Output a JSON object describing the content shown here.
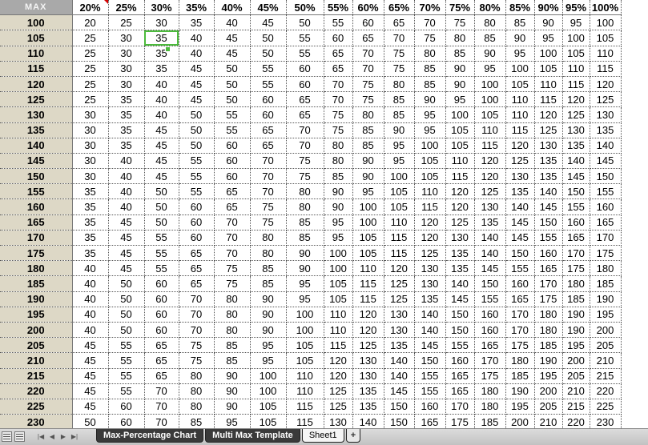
{
  "sheet": {
    "corner_label": "MAX",
    "percent_headers": [
      "20%",
      "25%",
      "30%",
      "35%",
      "40%",
      "45%",
      "50%",
      "55%",
      "60%",
      "65%",
      "70%",
      "75%",
      "80%",
      "85%",
      "90%",
      "95%",
      "100%"
    ],
    "rows": [
      {
        "max": "100",
        "values": [
          "20",
          "25",
          "30",
          "35",
          "40",
          "45",
          "50",
          "55",
          "60",
          "65",
          "70",
          "75",
          "80",
          "85",
          "90",
          "95",
          "100"
        ]
      },
      {
        "max": "105",
        "values": [
          "25",
          "30",
          "35",
          "40",
          "45",
          "50",
          "55",
          "60",
          "65",
          "70",
          "75",
          "80",
          "85",
          "90",
          "95",
          "100",
          "105"
        ]
      },
      {
        "max": "110",
        "values": [
          "25",
          "30",
          "35",
          "40",
          "45",
          "50",
          "55",
          "65",
          "70",
          "75",
          "80",
          "85",
          "90",
          "95",
          "100",
          "105",
          "110"
        ]
      },
      {
        "max": "115",
        "values": [
          "25",
          "30",
          "35",
          "45",
          "50",
          "55",
          "60",
          "65",
          "70",
          "75",
          "85",
          "90",
          "95",
          "100",
          "105",
          "110",
          "115"
        ]
      },
      {
        "max": "120",
        "values": [
          "25",
          "30",
          "40",
          "45",
          "50",
          "55",
          "60",
          "70",
          "75",
          "80",
          "85",
          "90",
          "100",
          "105",
          "110",
          "115",
          "120"
        ]
      },
      {
        "max": "125",
        "values": [
          "25",
          "35",
          "40",
          "45",
          "50",
          "60",
          "65",
          "70",
          "75",
          "85",
          "90",
          "95",
          "100",
          "110",
          "115",
          "120",
          "125"
        ]
      },
      {
        "max": "130",
        "values": [
          "30",
          "35",
          "40",
          "50",
          "55",
          "60",
          "65",
          "75",
          "80",
          "85",
          "95",
          "100",
          "105",
          "110",
          "120",
          "125",
          "130"
        ]
      },
      {
        "max": "135",
        "values": [
          "30",
          "35",
          "45",
          "50",
          "55",
          "65",
          "70",
          "75",
          "85",
          "90",
          "95",
          "105",
          "110",
          "115",
          "125",
          "130",
          "135"
        ]
      },
      {
        "max": "140",
        "values": [
          "30",
          "35",
          "45",
          "50",
          "60",
          "65",
          "70",
          "80",
          "85",
          "95",
          "100",
          "105",
          "115",
          "120",
          "130",
          "135",
          "140"
        ]
      },
      {
        "max": "145",
        "values": [
          "30",
          "40",
          "45",
          "55",
          "60",
          "70",
          "75",
          "80",
          "90",
          "95",
          "105",
          "110",
          "120",
          "125",
          "135",
          "140",
          "145"
        ]
      },
      {
        "max": "150",
        "values": [
          "30",
          "40",
          "45",
          "55",
          "60",
          "70",
          "75",
          "85",
          "90",
          "100",
          "105",
          "115",
          "120",
          "130",
          "135",
          "145",
          "150"
        ]
      },
      {
        "max": "155",
        "values": [
          "35",
          "40",
          "50",
          "55",
          "65",
          "70",
          "80",
          "90",
          "95",
          "105",
          "110",
          "120",
          "125",
          "135",
          "140",
          "150",
          "155"
        ]
      },
      {
        "max": "160",
        "values": [
          "35",
          "40",
          "50",
          "60",
          "65",
          "75",
          "80",
          "90",
          "100",
          "105",
          "115",
          "120",
          "130",
          "140",
          "145",
          "155",
          "160"
        ]
      },
      {
        "max": "165",
        "values": [
          "35",
          "45",
          "50",
          "60",
          "70",
          "75",
          "85",
          "95",
          "100",
          "110",
          "120",
          "125",
          "135",
          "145",
          "150",
          "160",
          "165"
        ]
      },
      {
        "max": "170",
        "values": [
          "35",
          "45",
          "55",
          "60",
          "70",
          "80",
          "85",
          "95",
          "105",
          "115",
          "120",
          "130",
          "140",
          "145",
          "155",
          "165",
          "170"
        ]
      },
      {
        "max": "175",
        "values": [
          "35",
          "45",
          "55",
          "65",
          "70",
          "80",
          "90",
          "100",
          "105",
          "115",
          "125",
          "135",
          "140",
          "150",
          "160",
          "170",
          "175"
        ]
      },
      {
        "max": "180",
        "values": [
          "40",
          "45",
          "55",
          "65",
          "75",
          "85",
          "90",
          "100",
          "110",
          "120",
          "130",
          "135",
          "145",
          "155",
          "165",
          "175",
          "180"
        ]
      },
      {
        "max": "185",
        "values": [
          "40",
          "50",
          "60",
          "65",
          "75",
          "85",
          "95",
          "105",
          "115",
          "125",
          "130",
          "140",
          "150",
          "160",
          "170",
          "180",
          "185"
        ]
      },
      {
        "max": "190",
        "values": [
          "40",
          "50",
          "60",
          "70",
          "80",
          "90",
          "95",
          "105",
          "115",
          "125",
          "135",
          "145",
          "155",
          "165",
          "175",
          "185",
          "190"
        ]
      },
      {
        "max": "195",
        "values": [
          "40",
          "50",
          "60",
          "70",
          "80",
          "90",
          "100",
          "110",
          "120",
          "130",
          "140",
          "150",
          "160",
          "170",
          "180",
          "190",
          "195"
        ]
      },
      {
        "max": "200",
        "values": [
          "40",
          "50",
          "60",
          "70",
          "80",
          "90",
          "100",
          "110",
          "120",
          "130",
          "140",
          "150",
          "160",
          "170",
          "180",
          "190",
          "200"
        ]
      },
      {
        "max": "205",
        "values": [
          "45",
          "55",
          "65",
          "75",
          "85",
          "95",
          "105",
          "115",
          "125",
          "135",
          "145",
          "155",
          "165",
          "175",
          "185",
          "195",
          "205"
        ]
      },
      {
        "max": "210",
        "values": [
          "45",
          "55",
          "65",
          "75",
          "85",
          "95",
          "105",
          "120",
          "130",
          "140",
          "150",
          "160",
          "170",
          "180",
          "190",
          "200",
          "210"
        ]
      },
      {
        "max": "215",
        "values": [
          "45",
          "55",
          "65",
          "80",
          "90",
          "100",
          "110",
          "120",
          "130",
          "140",
          "155",
          "165",
          "175",
          "185",
          "195",
          "205",
          "215"
        ]
      },
      {
        "max": "220",
        "values": [
          "45",
          "55",
          "70",
          "80",
          "90",
          "100",
          "110",
          "125",
          "135",
          "145",
          "155",
          "165",
          "180",
          "190",
          "200",
          "210",
          "220"
        ]
      },
      {
        "max": "225",
        "values": [
          "45",
          "60",
          "70",
          "80",
          "90",
          "105",
          "115",
          "125",
          "135",
          "150",
          "160",
          "170",
          "180",
          "195",
          "205",
          "215",
          "225"
        ]
      },
      {
        "max": "230",
        "values": [
          "50",
          "60",
          "70",
          "85",
          "95",
          "105",
          "115",
          "130",
          "140",
          "150",
          "165",
          "175",
          "185",
          "200",
          "210",
          "220",
          "230"
        ]
      }
    ]
  },
  "tabs": [
    {
      "label": "Max-Percentage Chart",
      "active": false
    },
    {
      "label": "Multi Max Template",
      "active": false
    },
    {
      "label": "Sheet1",
      "active": true
    }
  ],
  "add_tab_label": "+",
  "nav": {
    "first": "|◀",
    "prev": "◀",
    "next": "▶",
    "last": "▶|"
  },
  "colors": {
    "max_column_bg": "#ddd8c6",
    "header_bg": "#a9a9a9",
    "selection": "#4cbb3c",
    "comment_marker": "#d40000"
  }
}
